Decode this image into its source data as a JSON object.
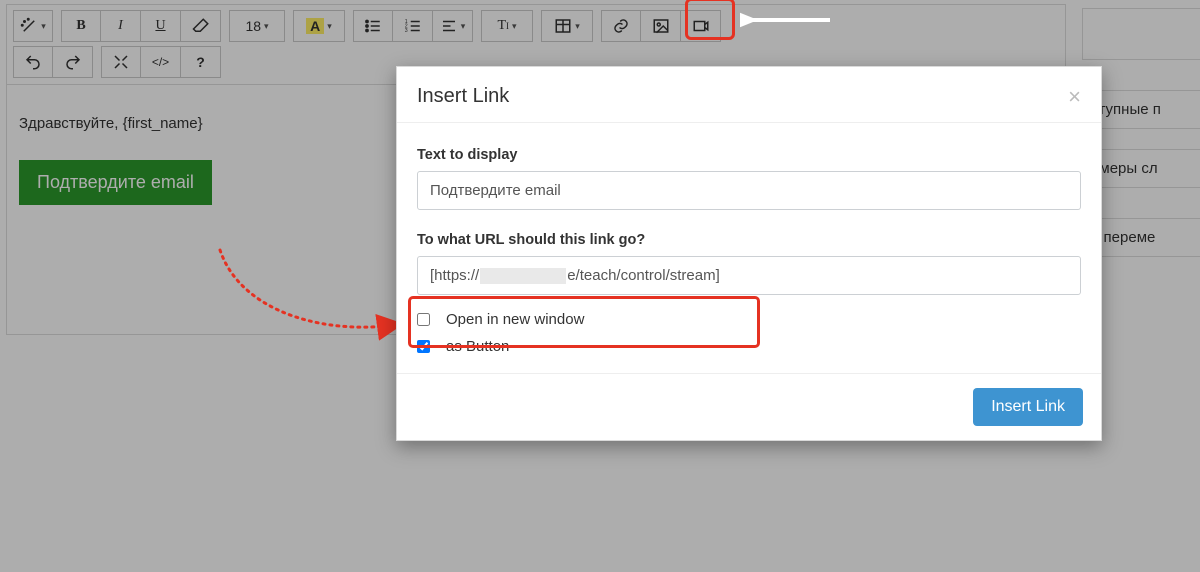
{
  "toolbar": {
    "font_size": "18",
    "highlight_letter": "A"
  },
  "editor": {
    "greeting": "Здравствуйте, {first_name}",
    "confirm_button": "Подтвердите email"
  },
  "sidebar": {
    "items": [
      "",
      "ступные п",
      "имеры сл",
      "и переме"
    ]
  },
  "dialog": {
    "title": "Insert Link",
    "text_label": "Text to display",
    "text_value": "Подтвердите email",
    "url_label": "To what URL should this link go?",
    "url_value_prefix": "[https://",
    "url_value_suffix": "e/teach/control/stream]",
    "open_new_window": "Open in new window",
    "open_new_window_checked": false,
    "as_button": "as Button",
    "as_button_checked": true,
    "submit": "Insert Link"
  }
}
